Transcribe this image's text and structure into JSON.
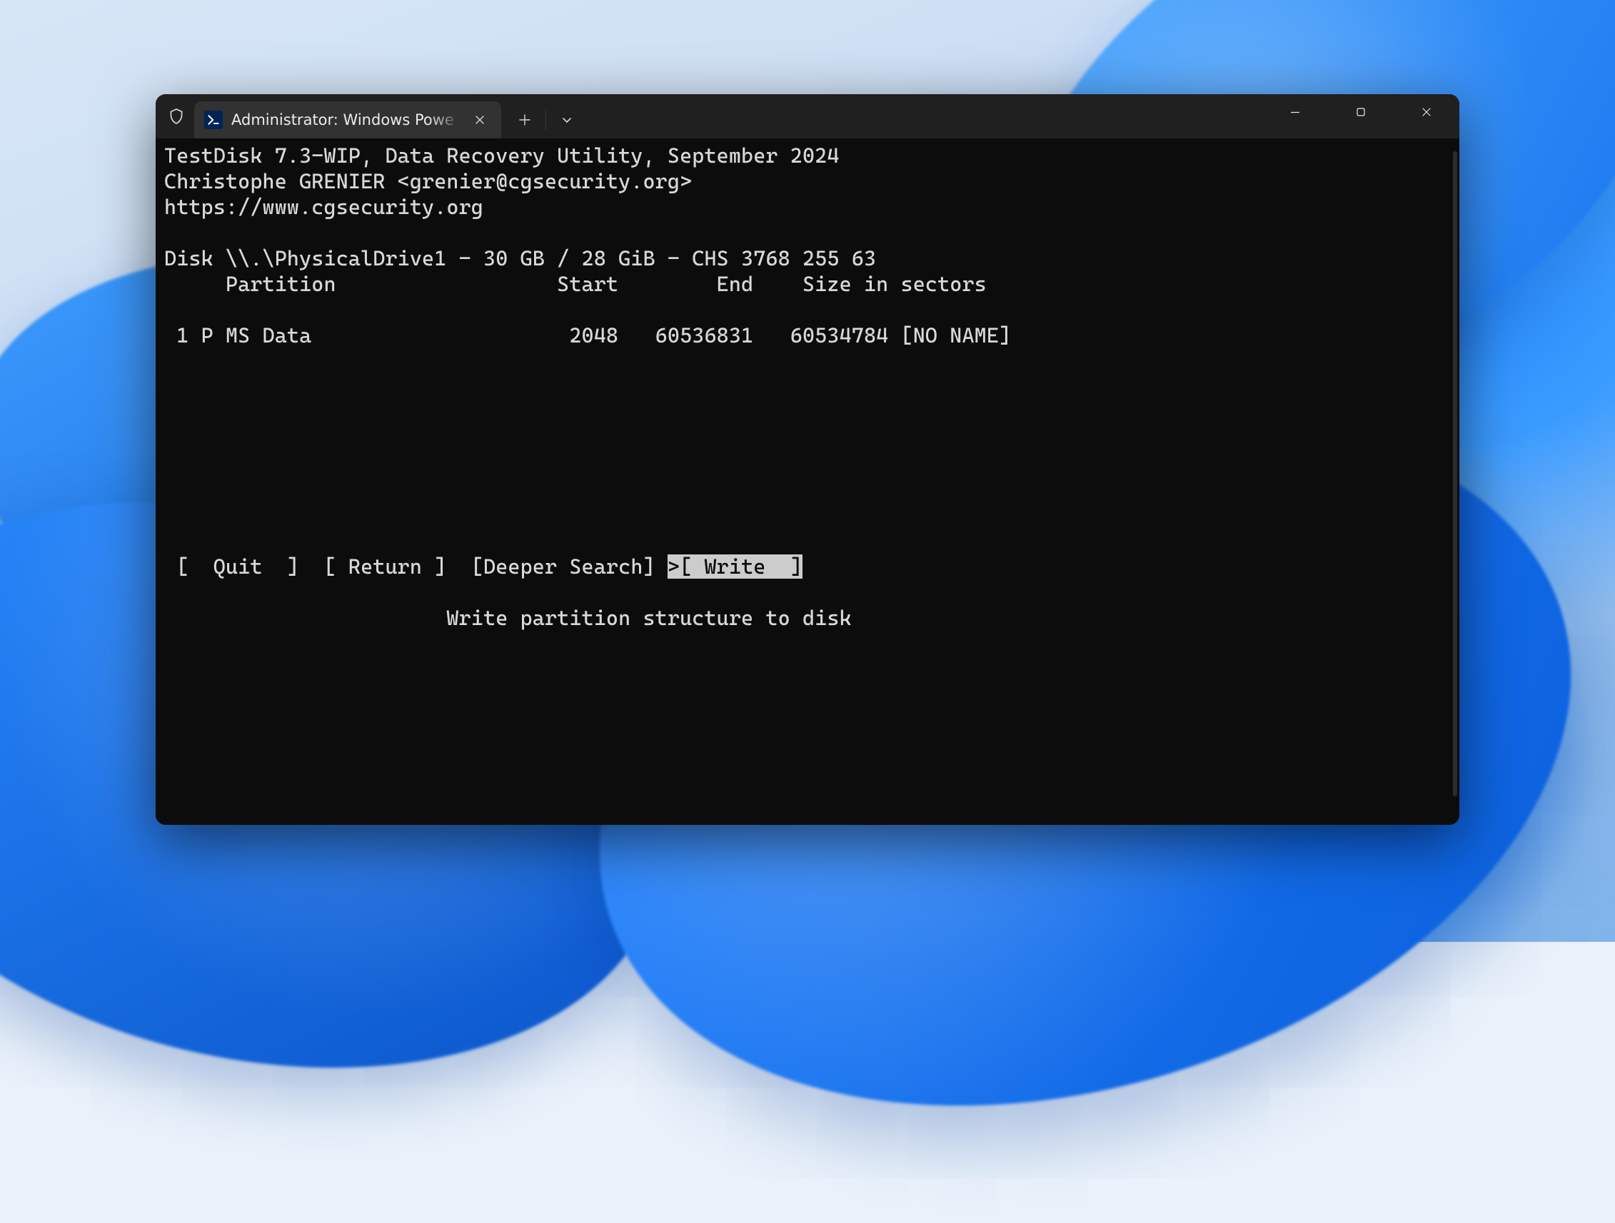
{
  "tab": {
    "title": "Administrator: Windows Powe",
    "icon": "powershell-icon"
  },
  "titlebar": {
    "shield_icon": "admin-shield-icon",
    "new_tab_icon": "plus-icon",
    "dropdown_icon": "chevron-down-icon",
    "minimize_icon": "minimize-icon",
    "maximize_icon": "maximize-icon",
    "close_icon": "close-icon",
    "tab_close_icon": "x-icon"
  },
  "terminal": {
    "line1": "TestDisk 7.3-WIP, Data Recovery Utility, September 2024",
    "line2": "Christophe GRENIER <grenier@cgsecurity.org>",
    "line3": "https://www.cgsecurity.org",
    "blank1": "",
    "disk_line": "Disk \\\\.\\PhysicalDrive1 - 30 GB / 28 GiB - CHS 3768 255 63",
    "header_line": "     Partition                  Start        End    Size in sectors",
    "blank2": "",
    "partition_line": " 1 P MS Data                     2048   60536831   60534784 [NO NAME]",
    "menu_quit": " [  Quit  ] ",
    "menu_return": " [ Return ] ",
    "menu_deeper_search": " [Deeper Search] ",
    "menu_marker": ">",
    "menu_write": "[ Write  ]",
    "hint": "                       Write partition structure to disk"
  }
}
